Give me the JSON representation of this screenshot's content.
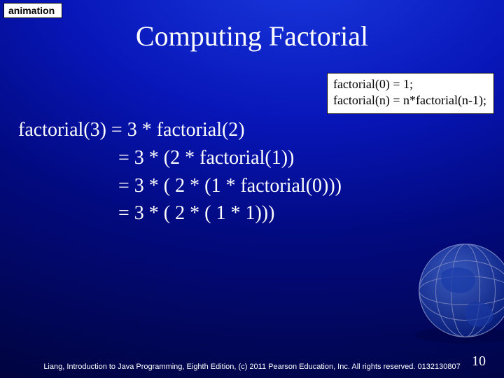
{
  "label": "animation",
  "title": "Computing Factorial",
  "rules": {
    "line1": "factorial(0) = 1;",
    "line2": "factorial(n) = n*factorial(n-1);"
  },
  "expansion": {
    "line1": "factorial(3) = 3 * factorial(2)",
    "line2": "= 3 * (2 * factorial(1))",
    "line3": "= 3 * ( 2 * (1 * factorial(0)))",
    "line4": "= 3 * ( 2 * ( 1 * 1)))"
  },
  "footer": "Liang, Introduction to Java Programming, Eighth Edition, (c) 2011 Pearson Education, Inc. All rights reserved. 0132130807",
  "page": "10"
}
